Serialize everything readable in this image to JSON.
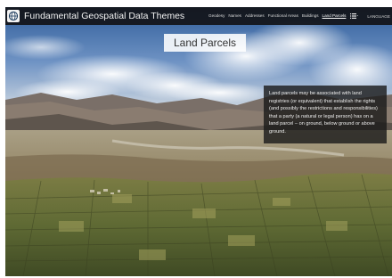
{
  "header": {
    "title": "Fundamental Geospatial Data Themes",
    "logo_icon": "globe-icon",
    "nav_items": [
      {
        "label": "Geodesy",
        "active": false
      },
      {
        "label": "Names",
        "active": false
      },
      {
        "label": "Addresses",
        "active": false
      },
      {
        "label": "Functional Areas",
        "active": false
      },
      {
        "label": "Buildings",
        "active": false
      },
      {
        "label": "Land Parcels",
        "active": true
      }
    ],
    "menu_icon": "list-icon",
    "language": "LANGUAGE"
  },
  "main": {
    "page_title": "Land Parcels",
    "description": "Land parcels may be associated with land registries (or equivalent) that establish the rights (and possibly the restrictions and responsibilities) that a party (a natural or legal person) has on a land parcel – on ground, below ground or above ground."
  },
  "colors": {
    "topbar": "#121418",
    "active_nav": "#ffffff",
    "info_box": "#191919"
  }
}
